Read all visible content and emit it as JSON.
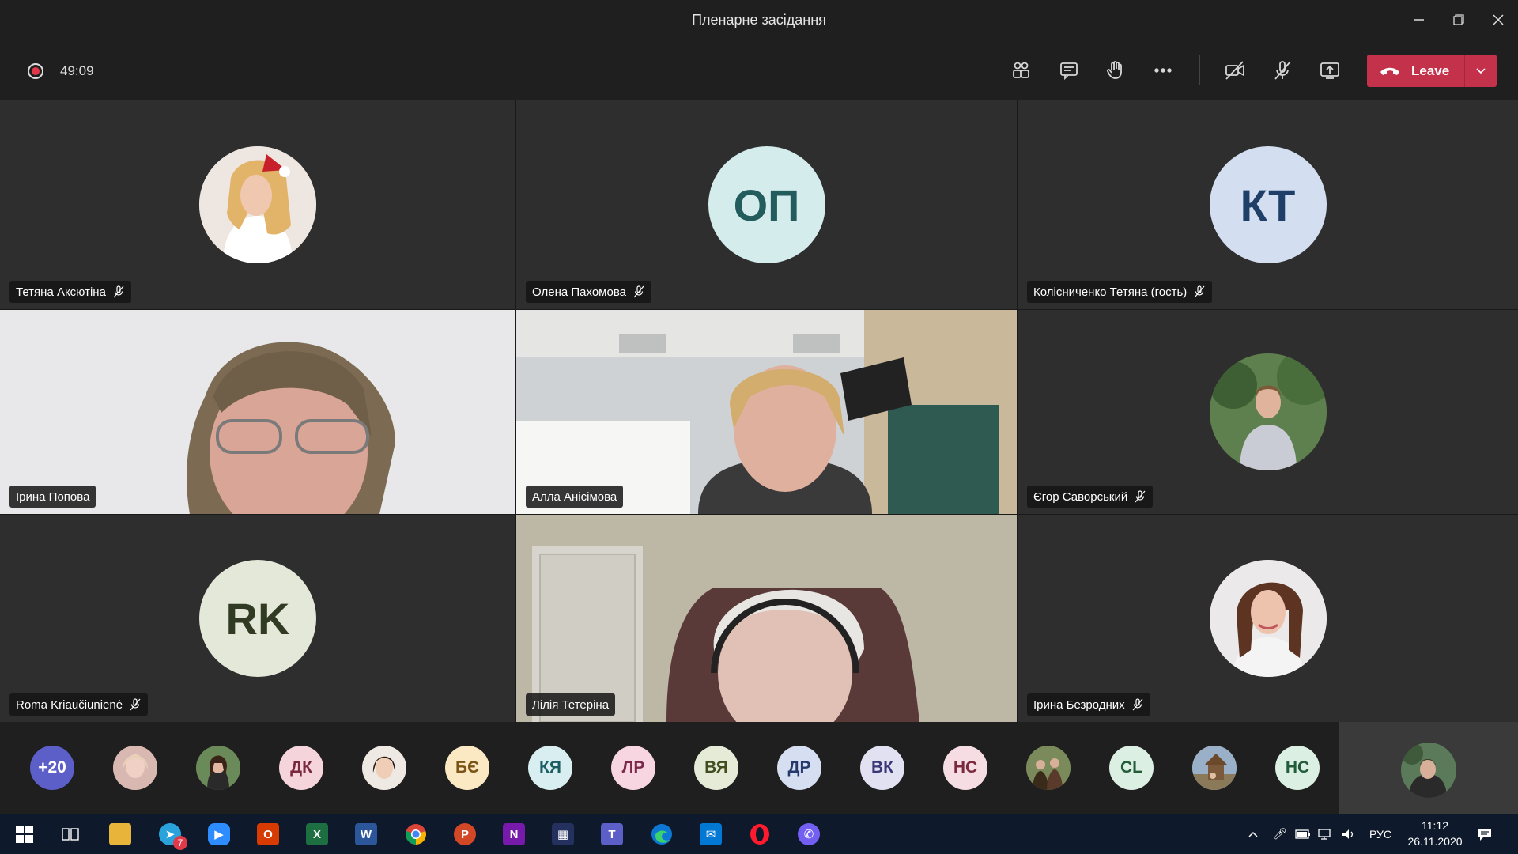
{
  "window": {
    "title": "Пленарне засідання"
  },
  "meeting": {
    "timer": "49:09",
    "leave_label": "Leave"
  },
  "tiles": [
    {
      "name": "Тетяна Аксютіна"
    },
    {
      "name": "Олена Пахомова",
      "initials": "ОП",
      "bg": "#d5ecec",
      "fg": "#235c5c"
    },
    {
      "name": "Колісниченко Тетяна (гость)",
      "initials": "КТ",
      "bg": "#d3dff0",
      "fg": "#1f3e68"
    },
    {
      "name": "Ірина Попова"
    },
    {
      "name": "Алла Анісімова"
    },
    {
      "name": "Єгор Саворський"
    },
    {
      "name": "Roma Kriaučiūnienė",
      "initials": "RK",
      "bg": "#e4e8d9",
      "fg": "#313a22"
    },
    {
      "name": "Лілія Тетеріна"
    },
    {
      "name": "Ірина Безродних"
    }
  ],
  "strip": [
    {
      "label": "+20",
      "bg": "#5b5fc7",
      "fg": "#ffffff"
    },
    {
      "label": "",
      "photo": true,
      "bg": "#c9a7a2"
    },
    {
      "label": "",
      "photo": true,
      "bg": "#5a3a2c"
    },
    {
      "label": "ДК",
      "bg": "#f5d4dc",
      "fg": "#7a2740"
    },
    {
      "label": "",
      "photo": true,
      "bg": "#6b4a3a"
    },
    {
      "label": "БЄ",
      "bg": "#fbe9c3",
      "fg": "#7a5416"
    },
    {
      "label": "КЯ",
      "bg": "#d8eef0",
      "fg": "#1c5c63"
    },
    {
      "label": "ЛР",
      "bg": "#f7d6e1",
      "fg": "#7a2a48"
    },
    {
      "label": "ВЯ",
      "bg": "#e5ebd6",
      "fg": "#3f4d1f"
    },
    {
      "label": "ДР",
      "bg": "#d6def2",
      "fg": "#25396b"
    },
    {
      "label": "ВК",
      "bg": "#e2e1f2",
      "fg": "#3a3777"
    },
    {
      "label": "НС",
      "bg": "#f6dde3",
      "fg": "#7a2a3f"
    },
    {
      "label": "",
      "photo": true,
      "bg": "#4b5a3a"
    },
    {
      "label": "CL",
      "bg": "#dcefe3",
      "fg": "#235c3a"
    },
    {
      "label": "",
      "photo": true,
      "bg": "#8a7a5a"
    },
    {
      "label": "НС",
      "bg": "#dcefe3",
      "fg": "#235c3a"
    }
  ],
  "taskbar": {
    "telegram_badge": "7",
    "language": "РУС",
    "time": "11:12",
    "date": "26.11.2020"
  }
}
